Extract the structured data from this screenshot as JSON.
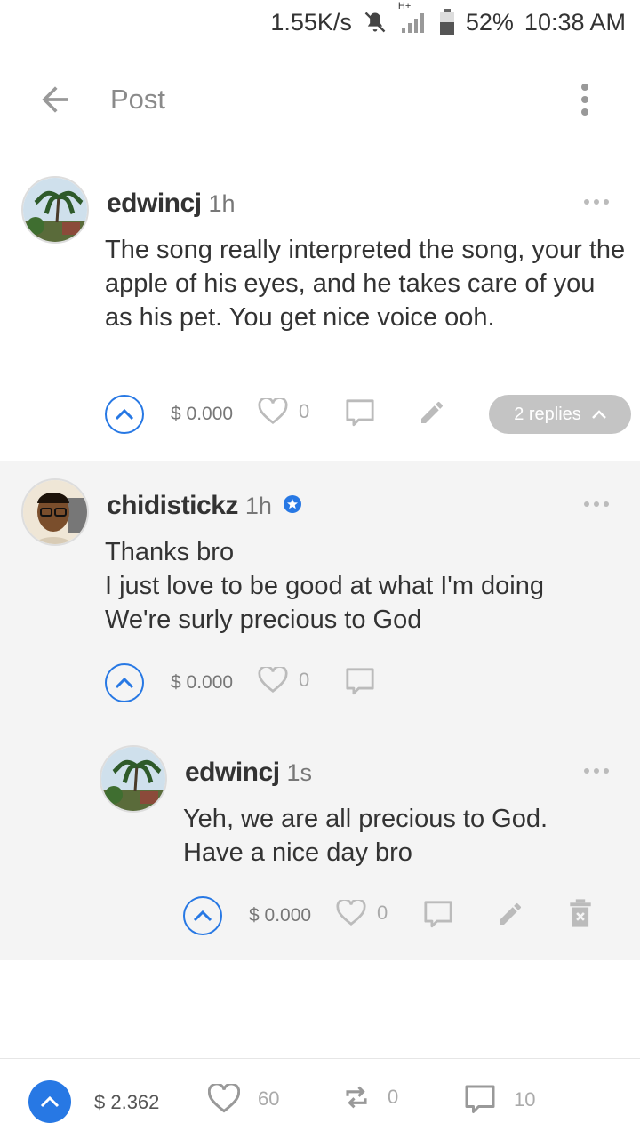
{
  "status_bar": {
    "net_speed": "1.55K/s",
    "network_type": "H+",
    "battery": "52%",
    "time": "10:38 AM",
    "icons": [
      "mute-icon",
      "signal-icon",
      "battery-icon"
    ]
  },
  "app_bar": {
    "title": "Post",
    "back_icon": "arrow-left-icon",
    "menu_icon": "more-vertical-icon"
  },
  "comments": [
    {
      "author": "edwincj",
      "age": "1h",
      "body": [
        "The song really interpreted the song, your the apple of his eyes, and he takes care of you as his pet. You get nice voice ooh."
      ],
      "payout": "$ 0.000",
      "likes": "0",
      "replies_label": "2 replies"
    },
    {
      "author": "chidistickz",
      "age": "1h",
      "verified": true,
      "body": [
        "Thanks bro",
        "I just love to be good at what I'm doing",
        "We're surly precious to God"
      ],
      "payout": "$ 0.000",
      "likes": "0"
    },
    {
      "author": "edwincj",
      "age": "1s",
      "body": [
        "Yeh, we are all precious to God.",
        "Have a nice day bro"
      ],
      "payout": "$ 0.000",
      "likes": "0"
    }
  ],
  "bottom_bar": {
    "payout": "$ 2.362",
    "likes": "60",
    "reblogs": "0",
    "comments": "10"
  },
  "colors": {
    "accent": "#2778e4",
    "reply_bg": "#f4f4f4",
    "pill": "#c4c4c4"
  }
}
